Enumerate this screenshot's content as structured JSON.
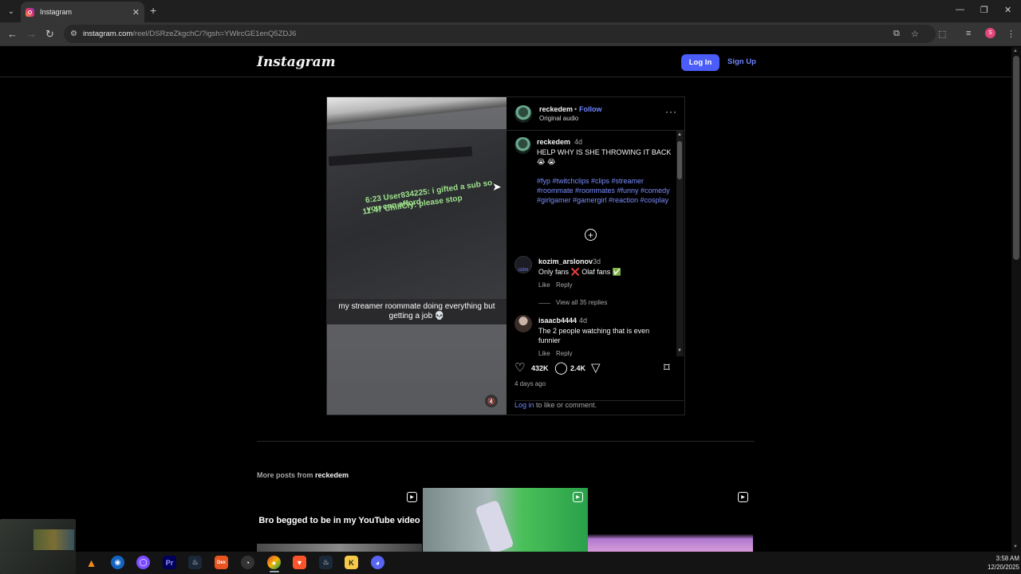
{
  "browser": {
    "tab_title": "Instagram",
    "url_host": "instagram.com",
    "url_path": "/reel/DSRzeZkgchC/?igsh=YWlrcGE1enQ5ZDJ6",
    "profile_initial": "S"
  },
  "ig_header": {
    "logo": "Instagram",
    "login_label": "Log In",
    "signup_label": "Sign Up"
  },
  "post": {
    "username": "reckedem",
    "follow_label": "Follow",
    "audio": "Original audio",
    "video_caption": "my streamer roommate doing everything but getting a job 💀",
    "video_chat_line1": "6:23 User834225: i gifted a sub so you can afford",
    "video_chat_line2": "11:47 ChillCiy: please stop",
    "caption_user": "reckedem",
    "caption_time": "4d",
    "caption_text": "HELP WHY IS SHE THROWING IT BACK 😭 😭",
    "caption_tags": "#fyp #twitchclips #clips #streamer #roommate #roommates #funny #comedy #girlgamer #gamergirl #reaction #cosplay",
    "comments": [
      {
        "user": "kozim_arslonov",
        "time": "3d",
        "text": "Only fans ❌ Olaf fans ✅",
        "like": "Like",
        "reply": "Reply",
        "view_replies": "View all 35 replies"
      },
      {
        "user": "isaacb4444",
        "time": "4d",
        "text": "The 2 people watching that is even funnier",
        "like": "Like",
        "reply": "Reply"
      }
    ],
    "likes": "432K",
    "comment_count": "2.4K",
    "posted": "4 days ago",
    "login_link": "Log in",
    "login_suffix": " to like or comment."
  },
  "more_posts": {
    "prefix": "More posts from ",
    "user": "reckedem",
    "thumbs": [
      {
        "text": "Bro begged to be in my YouTube video"
      },
      {
        "text": ""
      },
      {
        "text": ""
      }
    ]
  },
  "taskbar": {
    "time": "3:58 AM",
    "date": "12/20/2025"
  }
}
